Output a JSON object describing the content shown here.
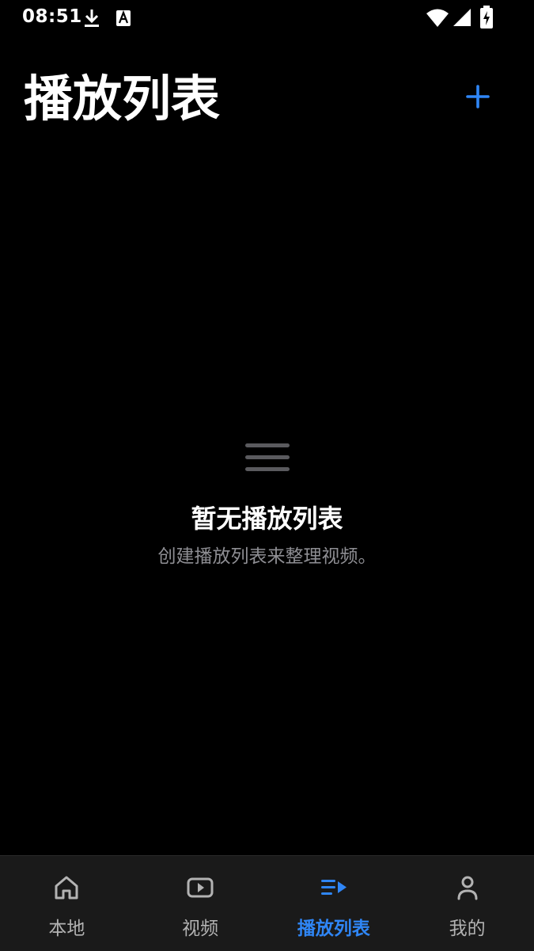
{
  "status_bar": {
    "time": "08:51",
    "icons": [
      "download-icon",
      "font-a-icon",
      "wifi-icon",
      "signal-icon",
      "battery-charging-icon"
    ]
  },
  "header": {
    "title": "播放列表",
    "add_icon": "plus-icon"
  },
  "empty_state": {
    "icon": "list-lines-icon",
    "title": "暂无播放列表",
    "subtitle": "创建播放列表来整理视频。"
  },
  "bottom_nav": {
    "items": [
      {
        "label": "本地",
        "icon": "home-icon",
        "active": false
      },
      {
        "label": "视频",
        "icon": "video-play-icon",
        "active": false
      },
      {
        "label": "播放列表",
        "icon": "playlist-icon",
        "active": true
      },
      {
        "label": "我的",
        "icon": "person-icon",
        "active": false
      }
    ]
  },
  "colors": {
    "background": "#000000",
    "accent": "#2f86f6",
    "nav_background": "#1a1a1a",
    "inactive": "#b3b3b3",
    "subtitle": "#8e8e93"
  }
}
